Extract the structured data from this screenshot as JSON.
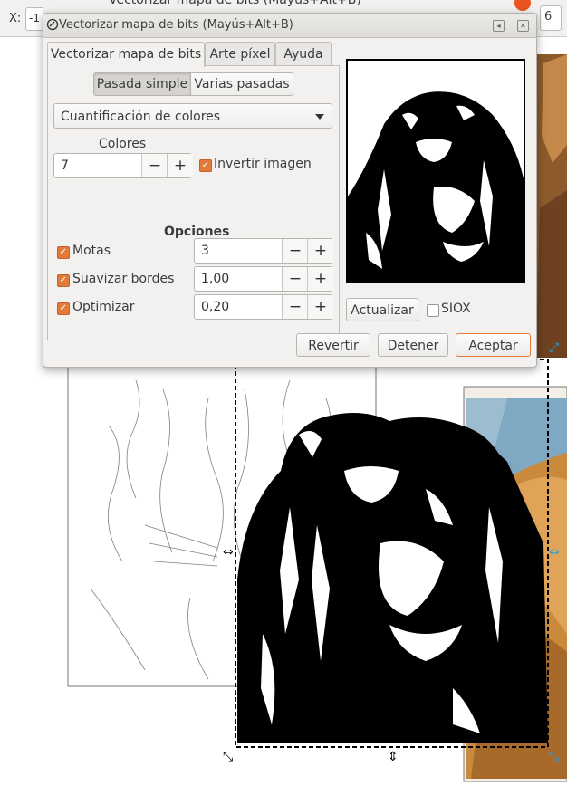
{
  "app": {
    "toolbar": {
      "x_label": "X:",
      "x_value": "-1",
      "right_value": "6"
    },
    "ghost_window_title": "Vectorizar mapa de bits (Mayús+Alt+B)"
  },
  "dialog": {
    "title": "Vectorizar mapa de bits (Mayús+Alt+B)",
    "tabs": [
      {
        "label": "Vectorizar mapa de bits",
        "active": true
      },
      {
        "label": "Arte píxel",
        "active": false
      },
      {
        "label": "Ayuda",
        "active": false
      }
    ],
    "mode_buttons": [
      {
        "label": "Pasada simple",
        "active": true
      },
      {
        "label": "Varias pasadas",
        "active": false
      }
    ],
    "method_select": "Cuantificación de colores",
    "colors": {
      "label": "Colores",
      "value": "7",
      "minus": "−",
      "plus": "+"
    },
    "invert": {
      "label": "Invertir imagen",
      "checked": true
    },
    "options_heading": "Opciones",
    "options": [
      {
        "label": "Motas",
        "checked": true,
        "value": "3"
      },
      {
        "label": "Suavizar bordes",
        "checked": true,
        "value": "1,00"
      },
      {
        "label": "Optimizar",
        "checked": true,
        "value": "0,20"
      }
    ],
    "update_button": "Actualizar",
    "siox": {
      "label": "SIOX",
      "checked": false
    },
    "footer_buttons": {
      "revert": "Revertir",
      "stop": "Detener",
      "accept": "Aceptar"
    },
    "colors_hex": {
      "accent": "#e07b39",
      "bg": "#f2f1f0"
    }
  }
}
